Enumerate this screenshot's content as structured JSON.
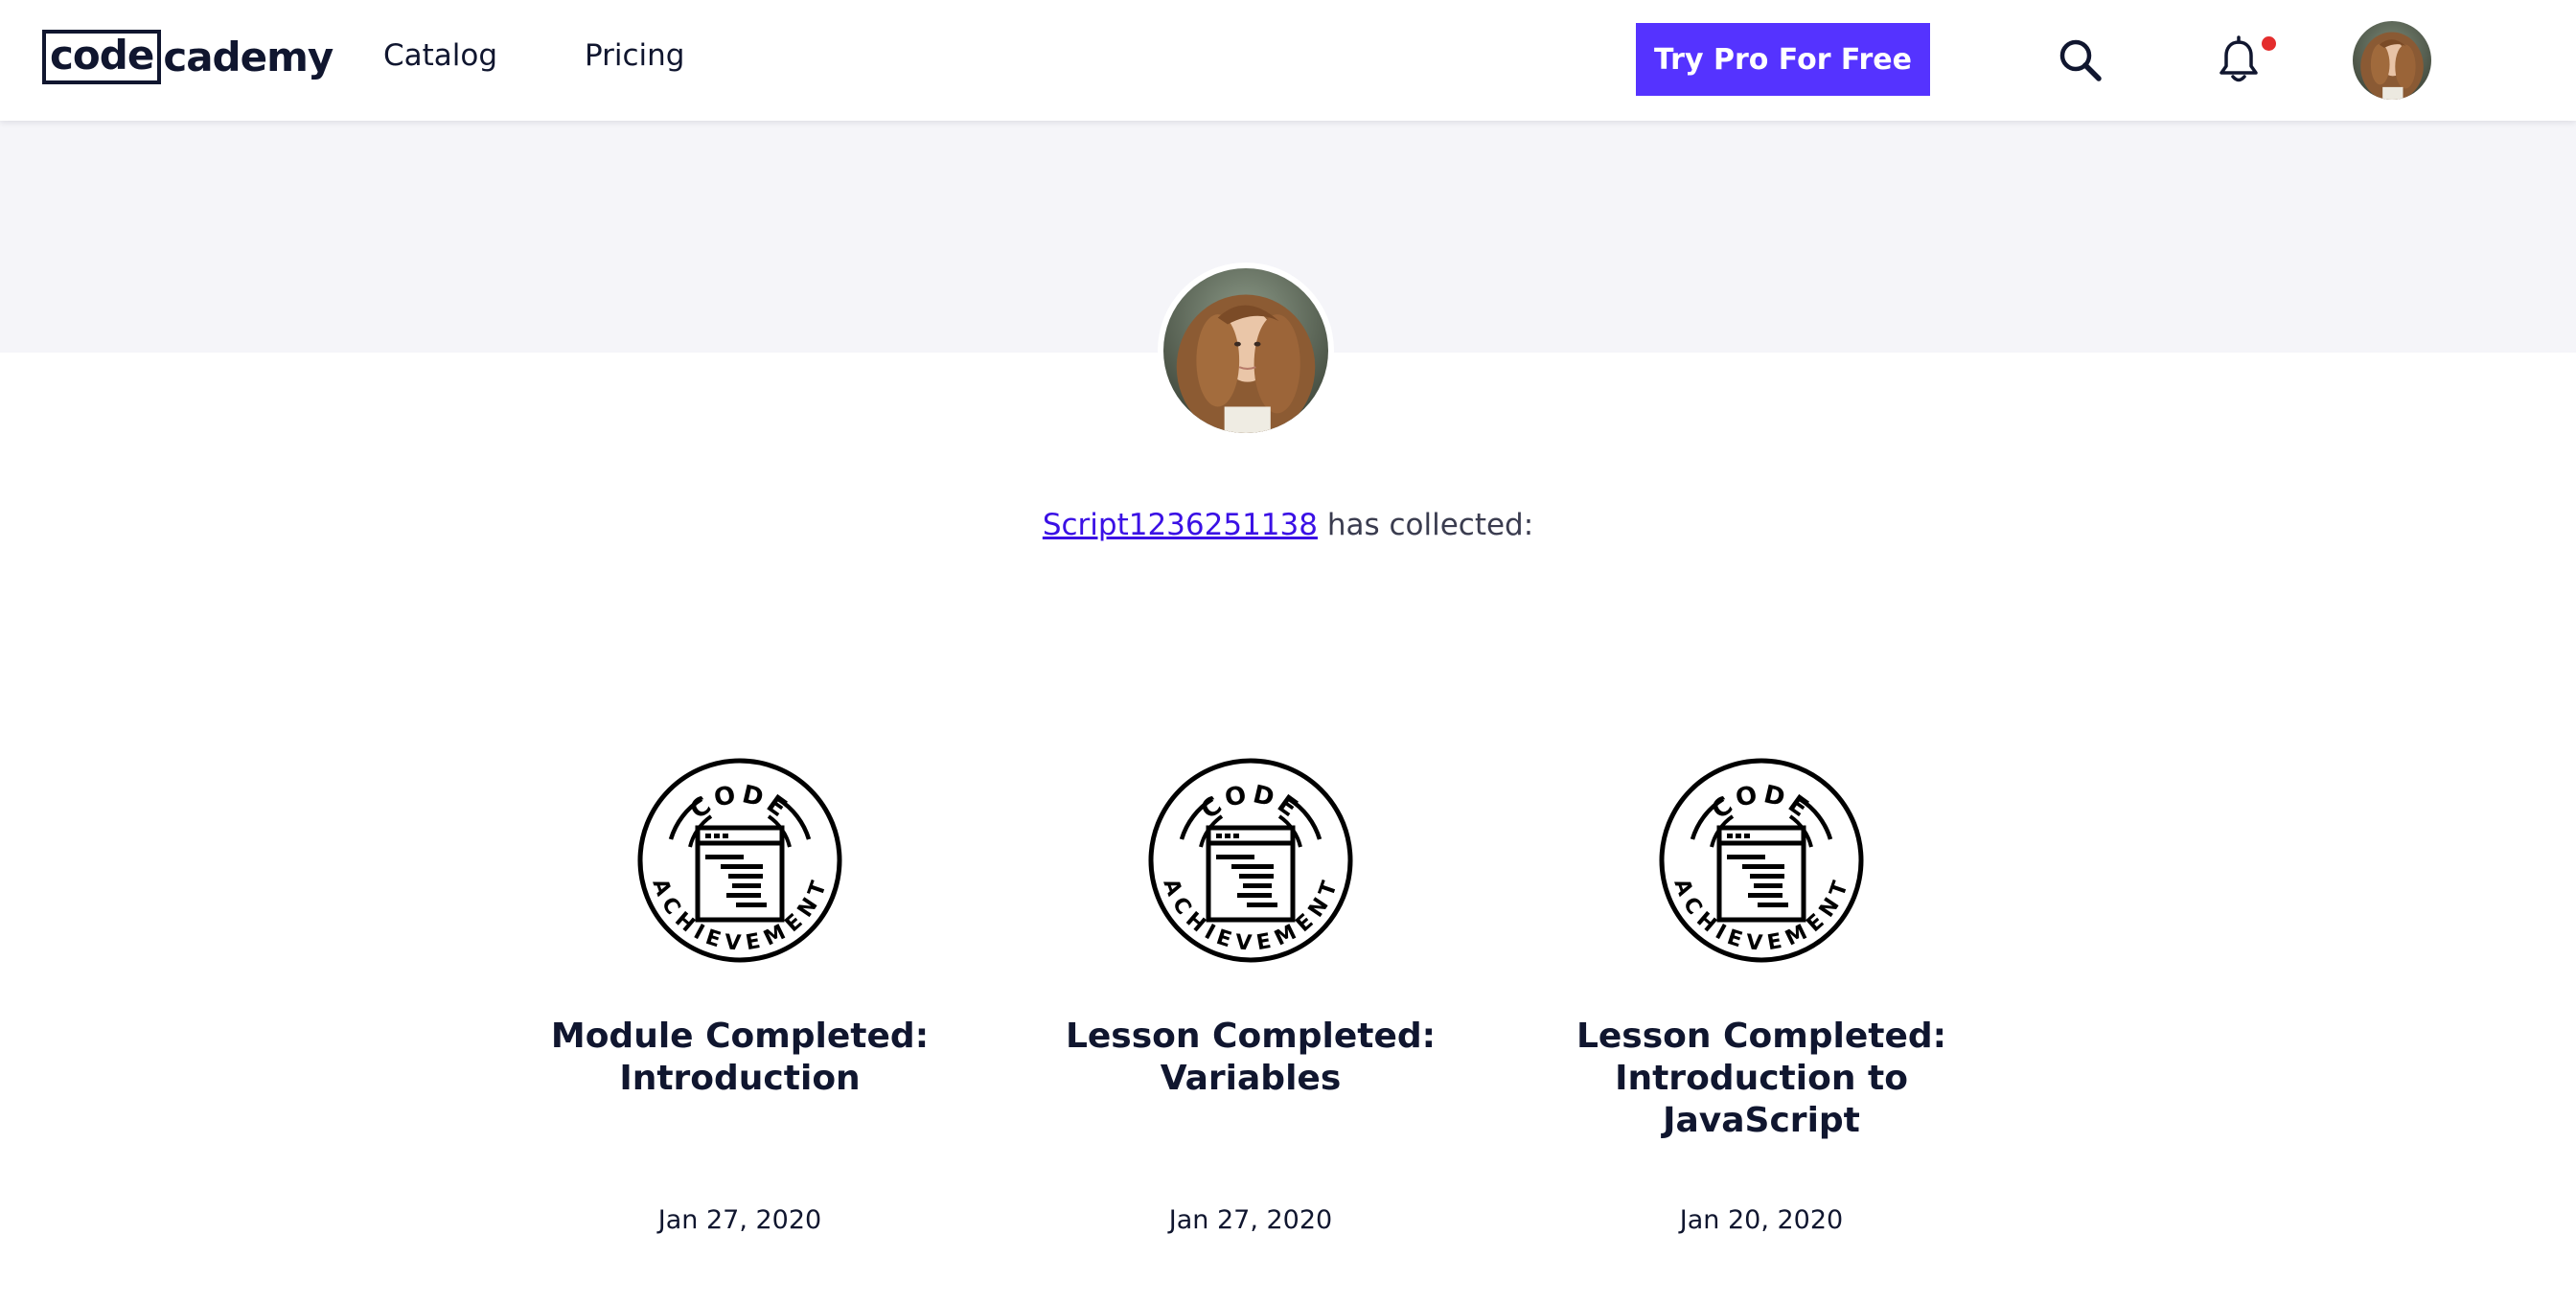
{
  "header": {
    "logo": {
      "boxed": "code",
      "rest": "cademy"
    },
    "nav": [
      {
        "label": "Catalog"
      },
      {
        "label": "Pricing"
      }
    ],
    "cta_label": "Try Pro For Free",
    "icons": [
      "search-icon",
      "bell-icon"
    ],
    "notification_dot": true
  },
  "profile": {
    "username": "Script1236251138",
    "collected_text": " has collected:"
  },
  "achievements": [
    {
      "badge_top": "CODE",
      "badge_bottom": "ACHIEVEMENT",
      "title": "Module Completed: Introduction",
      "date": "Jan 27, 2020"
    },
    {
      "badge_top": "CODE",
      "badge_bottom": "ACHIEVEMENT",
      "title": "Lesson Completed: Variables",
      "date": "Jan 27, 2020"
    },
    {
      "badge_top": "CODE",
      "badge_bottom": "ACHIEVEMENT",
      "title": "Lesson Completed: Introduction to JavaScript",
      "date": "Jan 20, 2020"
    }
  ],
  "colors": {
    "brand_purple": "#5533ff",
    "link": "#3a10e5",
    "navy": "#10162f",
    "banner": "#f5f5f9",
    "notification": "#e42d2d"
  }
}
